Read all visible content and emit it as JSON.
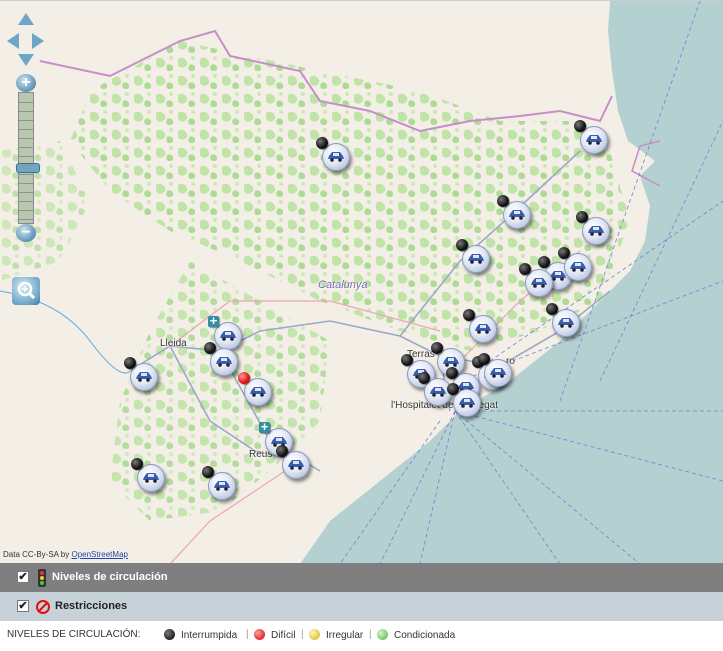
{
  "map": {
    "region_label": "Catalunya",
    "city_labels": {
      "lleida": "Lleida",
      "reus": "Reus",
      "terrassa": "Terras",
      "mataro": "ro",
      "hospitalet": "l'Hospitalet de Llobregat"
    },
    "attribution": {
      "prefix": "Data CC-By-SA by",
      "link": "OpenStreetMap"
    },
    "colors": {
      "land": "#f3efe6",
      "sea": "#b5d0d0",
      "vegetation": "#bde3a4",
      "border": "#c68ec7",
      "road": "#9aa8c8"
    }
  },
  "controls": {
    "zoom_in": "+",
    "zoom_out": "−"
  },
  "layers": {
    "traffic": {
      "label": "Niveles de circulación",
      "checked": true
    },
    "restrictions": {
      "label": "Restricciones",
      "checked": true
    }
  },
  "legend": {
    "title": "NIVELES DE CIRCULACIÓN:",
    "items": [
      {
        "label": "Interrumpida",
        "color": "#111111"
      },
      {
        "label": "Difícil",
        "color": "#e01010"
      },
      {
        "label": "Irregular",
        "color": "#e8d84a"
      },
      {
        "label": "Condicionada",
        "color": "#7fd070"
      }
    ]
  },
  "markers_legend_types": [
    "interrupted",
    "difficult",
    "restriction"
  ]
}
